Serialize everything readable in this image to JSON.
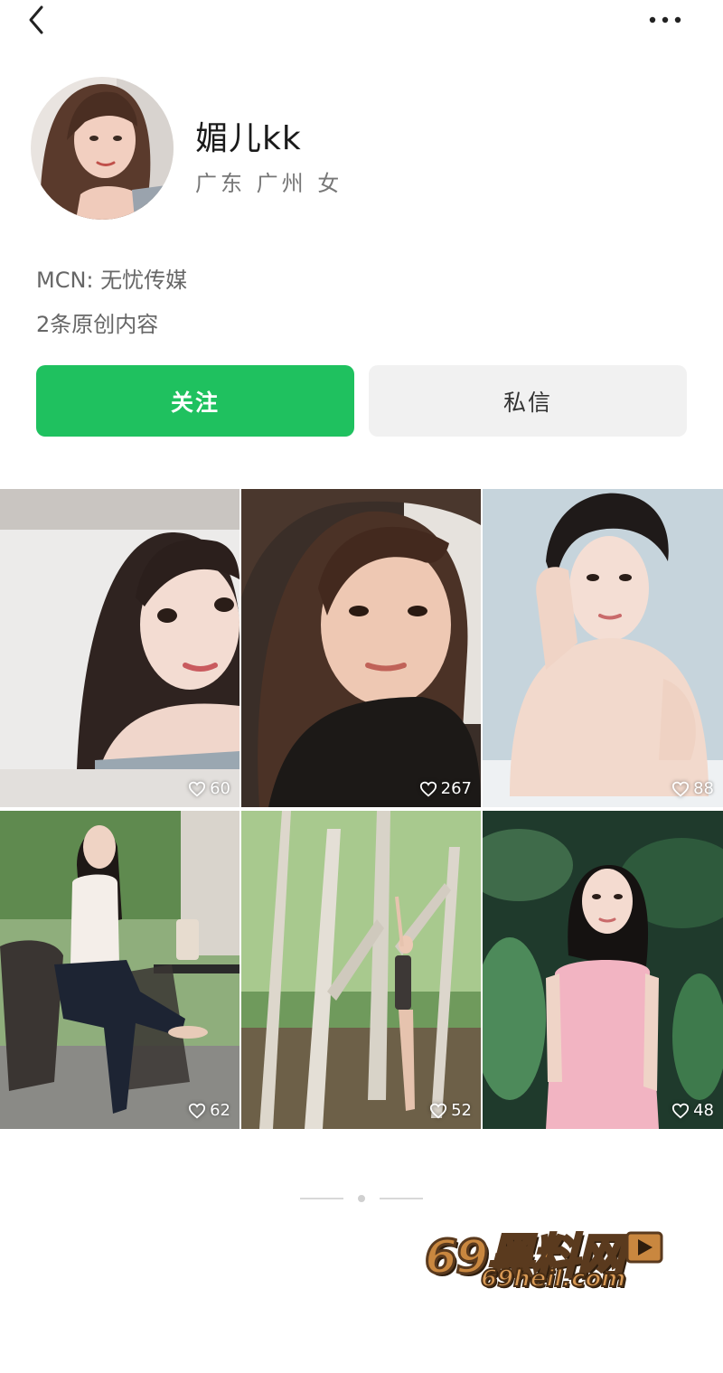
{
  "profile": {
    "nickname": "媚儿kk",
    "location": "广东 广州 女",
    "mcn": "MCN: 无忧传媒",
    "content_count": "2条原创内容"
  },
  "actions": {
    "follow_label": "关注",
    "message_label": "私信"
  },
  "colors": {
    "accent": "#1fc15f",
    "secondary_button": "#f1f1f1"
  },
  "posts": [
    {
      "likes": "60"
    },
    {
      "likes": "267"
    },
    {
      "likes": "88"
    },
    {
      "likes": "62"
    },
    {
      "likes": "52"
    },
    {
      "likes": "48"
    }
  ],
  "watermark": {
    "main": "69黑料网",
    "sub": "69heil.com"
  }
}
